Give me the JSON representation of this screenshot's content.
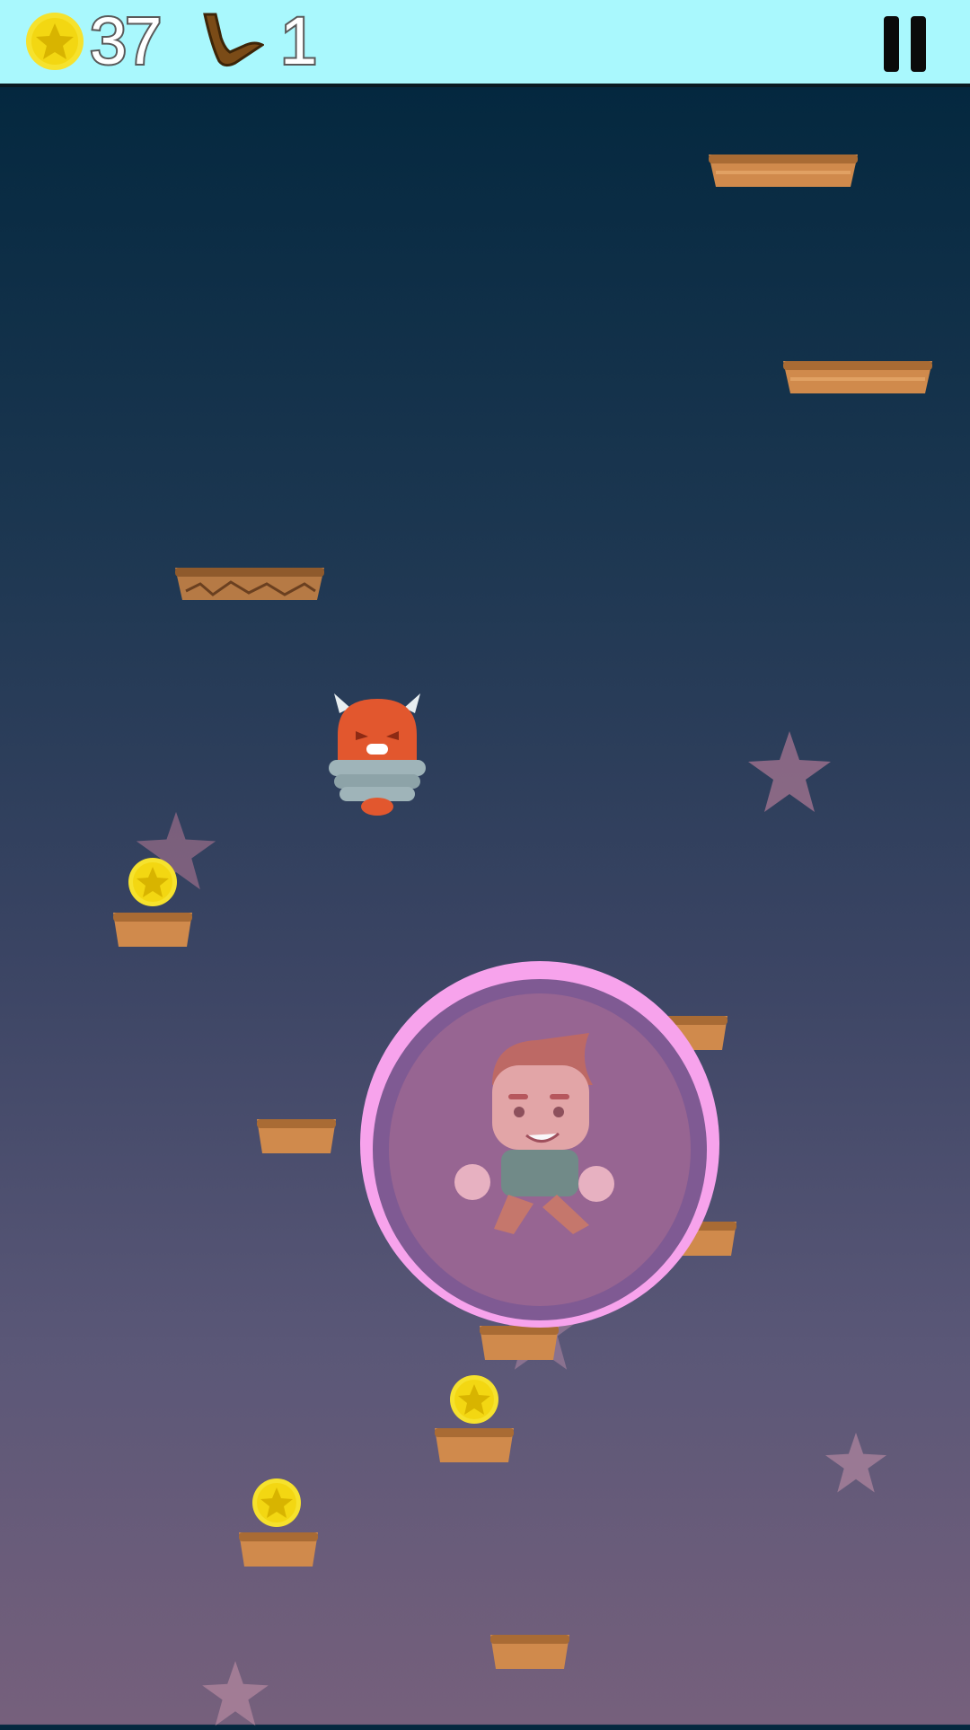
{
  "hud": {
    "coins": "37",
    "boomerangs": "1",
    "icons": [
      "star-coin-icon",
      "boomerang-icon",
      "pause-icon"
    ],
    "background_color": "#a9f8fd"
  },
  "scene": {
    "platform_types": [
      "wooden",
      "cracked"
    ],
    "collectibles": "star-coin",
    "enemy": "horned-red-spring-monster",
    "player_powerup": "pink-bubble-shield"
  },
  "colors": {
    "sky_top": "#04283f",
    "sky_bottom": "#76607c",
    "platform": "#d08a4c",
    "coin": "#f6e22d",
    "bubble": "#f7a3ec",
    "enemy": "#e2572e"
  }
}
